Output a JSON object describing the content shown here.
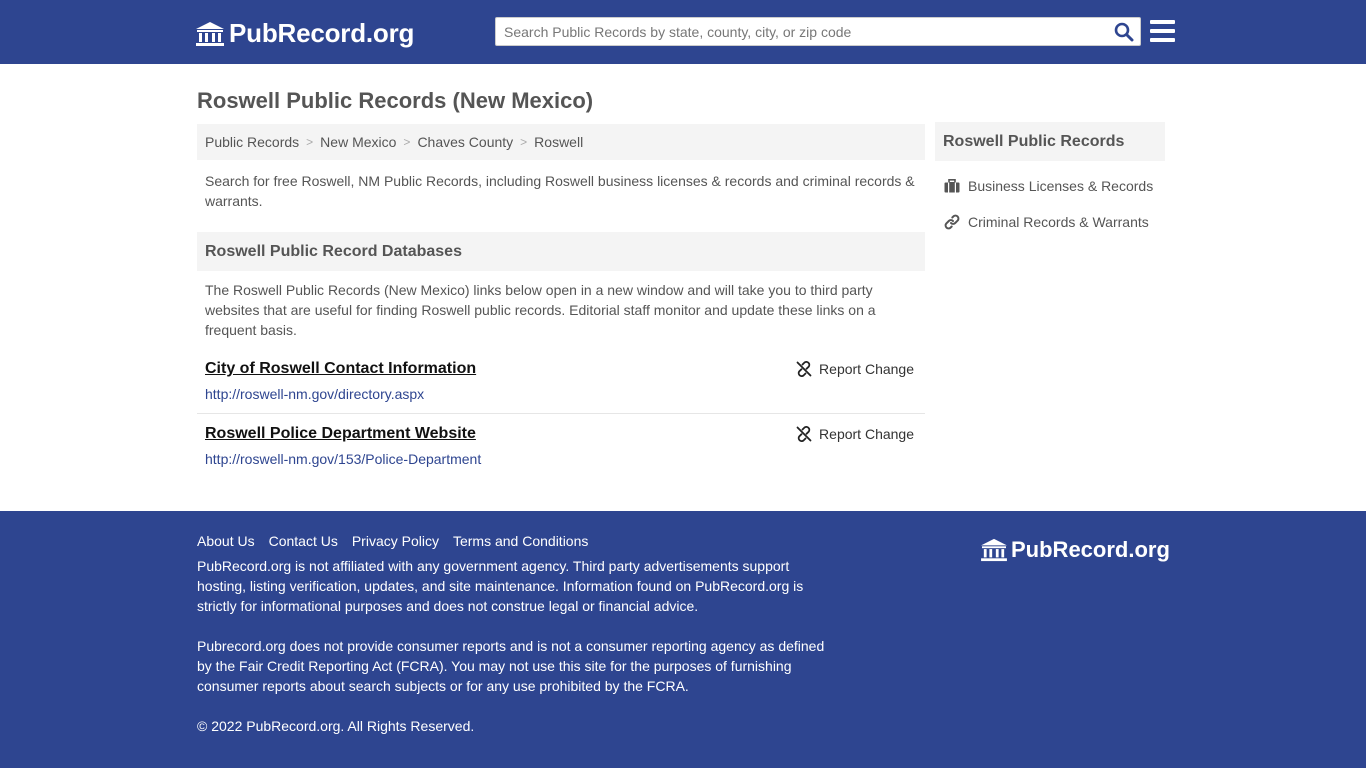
{
  "header": {
    "logo_text": "PubRecord.org",
    "search_placeholder": "Search Public Records by state, county, city, or zip code"
  },
  "main": {
    "title": "Roswell Public Records (New Mexico)",
    "breadcrumb": [
      "Public Records",
      "New Mexico",
      "Chaves County",
      "Roswell"
    ],
    "intro": "Search for free Roswell, NM Public Records, including Roswell business licenses & records and criminal records & warrants.",
    "section_title": "Roswell Public Record Databases",
    "section_desc": "The Roswell Public Records (New Mexico) links below open in a new window and will take you to third party websites that are useful for finding Roswell public records. Editorial staff monitor and update these links on a frequent basis.",
    "records": [
      {
        "title": "City of Roswell Contact Information",
        "url": "http://roswell-nm.gov/directory.aspx",
        "report": "Report Change"
      },
      {
        "title": "Roswell Police Department Website",
        "url": "http://roswell-nm.gov/153/Police-Department",
        "report": "Report Change"
      }
    ]
  },
  "sidebar": {
    "title": "Roswell Public Records",
    "items": [
      {
        "label": "Business Licenses & Records",
        "icon": "briefcase-icon"
      },
      {
        "label": "Criminal Records & Warrants",
        "icon": "link-icon"
      }
    ]
  },
  "footer": {
    "links": [
      "About Us",
      "Contact Us",
      "Privacy Policy",
      "Terms and Conditions"
    ],
    "disclaimer1": "PubRecord.org is not affiliated with any government agency. Third party advertisements support hosting, listing verification, updates, and site maintenance. Information found on PubRecord.org is strictly for informational purposes and does not construe legal or financial advice.",
    "disclaimer2": "Pubrecord.org does not provide consumer reports and is not a consumer reporting agency as defined by the Fair Credit Reporting Act (FCRA). You may not use this site for the purposes of furnishing consumer reports about search subjects or for any use prohibited by the FCRA.",
    "copyright": "© 2022 PubRecord.org. All Rights Reserved.",
    "logo_text": "PubRecord.org"
  },
  "colors": {
    "brand": "#2e4590",
    "panel": "#f4f4f4"
  }
}
